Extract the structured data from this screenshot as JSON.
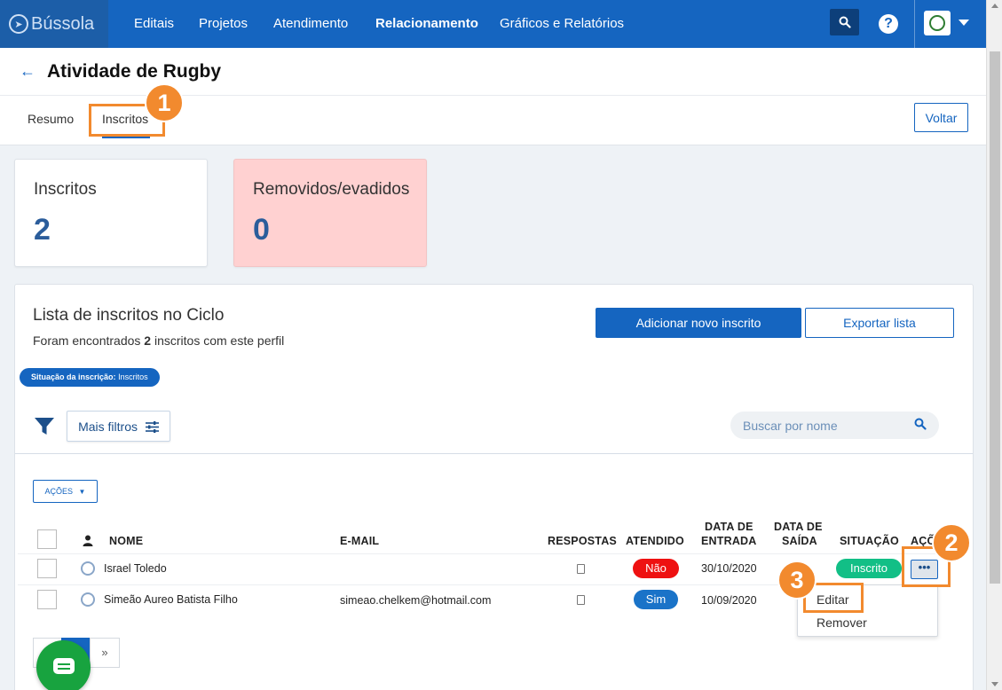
{
  "nav": {
    "brand": "Bússola",
    "items": [
      "Editais",
      "Projetos",
      "Atendimento",
      "Relacionamento",
      "Gráficos e Relatórios"
    ],
    "active": "Relacionamento",
    "help": "?"
  },
  "header": {
    "title": "Atividade de Rugby",
    "tabs": [
      "Resumo",
      "Inscritos"
    ],
    "active_tab": "Inscritos",
    "back_button": "Voltar"
  },
  "stats": [
    {
      "label": "Inscritos",
      "value": "2"
    },
    {
      "label": "Removidos/evadidos",
      "value": "0"
    }
  ],
  "list": {
    "title": "Lista de inscritos no Ciclo",
    "subtitle_prefix": "Foram encontrados",
    "subtitle_count": "2",
    "subtitle_suffix": "inscritos com este perfil",
    "add_button": "Adicionar novo inscrito",
    "export_button": "Exportar lista",
    "chip_key": "Situação da inscrição:",
    "chip_value": "Inscritos",
    "filters_button": "Mais filtros",
    "search_placeholder": "Buscar por nome",
    "actions_button": "AÇÕES"
  },
  "table": {
    "columns": {
      "name": "NOME",
      "email": "E-MAIL",
      "responses": "RESPOSTAS",
      "attended": "ATENDIDO",
      "entry_1": "DATA DE",
      "entry_2": "ENTRADA",
      "exit_1": "DATA DE",
      "exit_2": "SAÍDA",
      "status": "SITUAÇÃO",
      "actions": "AÇÕ"
    },
    "rows": [
      {
        "name": "Israel Toledo",
        "email": "",
        "attended": "Não",
        "entry_date": "30/10/2020",
        "status": "Inscrito",
        "actions": "•••"
      },
      {
        "name": "Simeão Aureo Batista Filho",
        "email": "simeao.chelkem@hotmail.com",
        "attended": "Sim",
        "entry_date": "10/09/2020"
      }
    ]
  },
  "menu": {
    "items": [
      "Editar",
      "Remover"
    ]
  },
  "pagination": {
    "next": "»"
  },
  "annotations": [
    "1",
    "2",
    "3"
  ],
  "colors": {
    "primary": "#1565c0",
    "danger_card": "#ffd1d1",
    "pill_no": "#ee1111",
    "pill_yes": "#1a73c8",
    "pill_status": "#12bf86",
    "annotation": "#f28a2e",
    "chat": "#18a33f"
  }
}
